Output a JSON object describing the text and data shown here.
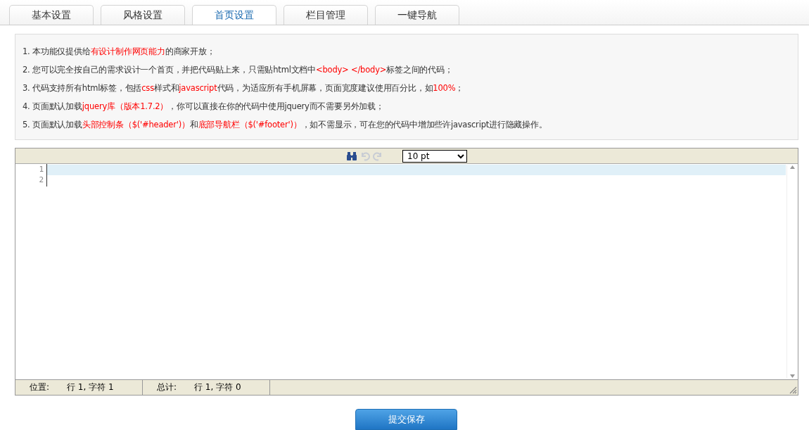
{
  "tabs": [
    {
      "label": "基本设置",
      "selected": false
    },
    {
      "label": "风格设置",
      "selected": false
    },
    {
      "label": "首页设置",
      "selected": true
    },
    {
      "label": "栏目管理",
      "selected": false
    },
    {
      "label": "一键导航",
      "selected": false
    }
  ],
  "notes": [
    {
      "segments": [
        {
          "text": "1. 本功能仅提供给",
          "highlight": false
        },
        {
          "text": "有设计制作网页能力",
          "highlight": true
        },
        {
          "text": "的商家开放；",
          "highlight": false
        }
      ]
    },
    {
      "segments": [
        {
          "text": "2. 您可以完全按自己的需求设计一个首页，并把代码贴上来，只需贴html文档中",
          "highlight": false
        },
        {
          "text": "<body> </body>",
          "highlight": true
        },
        {
          "text": "标签之间的代码；",
          "highlight": false
        }
      ]
    },
    {
      "segments": [
        {
          "text": "3. 代码支持所有html标签，包括",
          "highlight": false
        },
        {
          "text": "css",
          "highlight": true
        },
        {
          "text": "样式和",
          "highlight": false
        },
        {
          "text": "javascript",
          "highlight": true
        },
        {
          "text": "代码，为适应所有手机屏幕，页面宽度建议使用百分比，如",
          "highlight": false
        },
        {
          "text": "100%",
          "highlight": true
        },
        {
          "text": "；",
          "highlight": false
        }
      ]
    },
    {
      "segments": [
        {
          "text": "4. 页面默认加载",
          "highlight": false
        },
        {
          "text": "jquery库（版本1.7.2）",
          "highlight": true
        },
        {
          "text": "，你可以直接在你的代码中使用jquery而不需要另外加载；",
          "highlight": false
        }
      ]
    },
    {
      "segments": [
        {
          "text": "5. 页面默认加载",
          "highlight": false
        },
        {
          "text": "头部控制条（$('#header')）",
          "highlight": true
        },
        {
          "text": "和",
          "highlight": false
        },
        {
          "text": "底部导航栏（$('#footer')）",
          "highlight": true
        },
        {
          "text": "，如不需显示，可在您的代码中增加些许javascript进行隐藏操作。",
          "highlight": false
        }
      ]
    }
  ],
  "editor": {
    "undo_disabled": true,
    "redo_disabled": true,
    "font_size": "10 pt",
    "lines": [
      {
        "number": "1",
        "current": true
      },
      {
        "number": "2",
        "current": false
      }
    ]
  },
  "status_bar": [
    {
      "label": "位置:",
      "value": "行 1, 字符 1"
    },
    {
      "label": "总计:",
      "value": "行 1, 字符 0"
    }
  ],
  "submit_button": "提交保存"
}
